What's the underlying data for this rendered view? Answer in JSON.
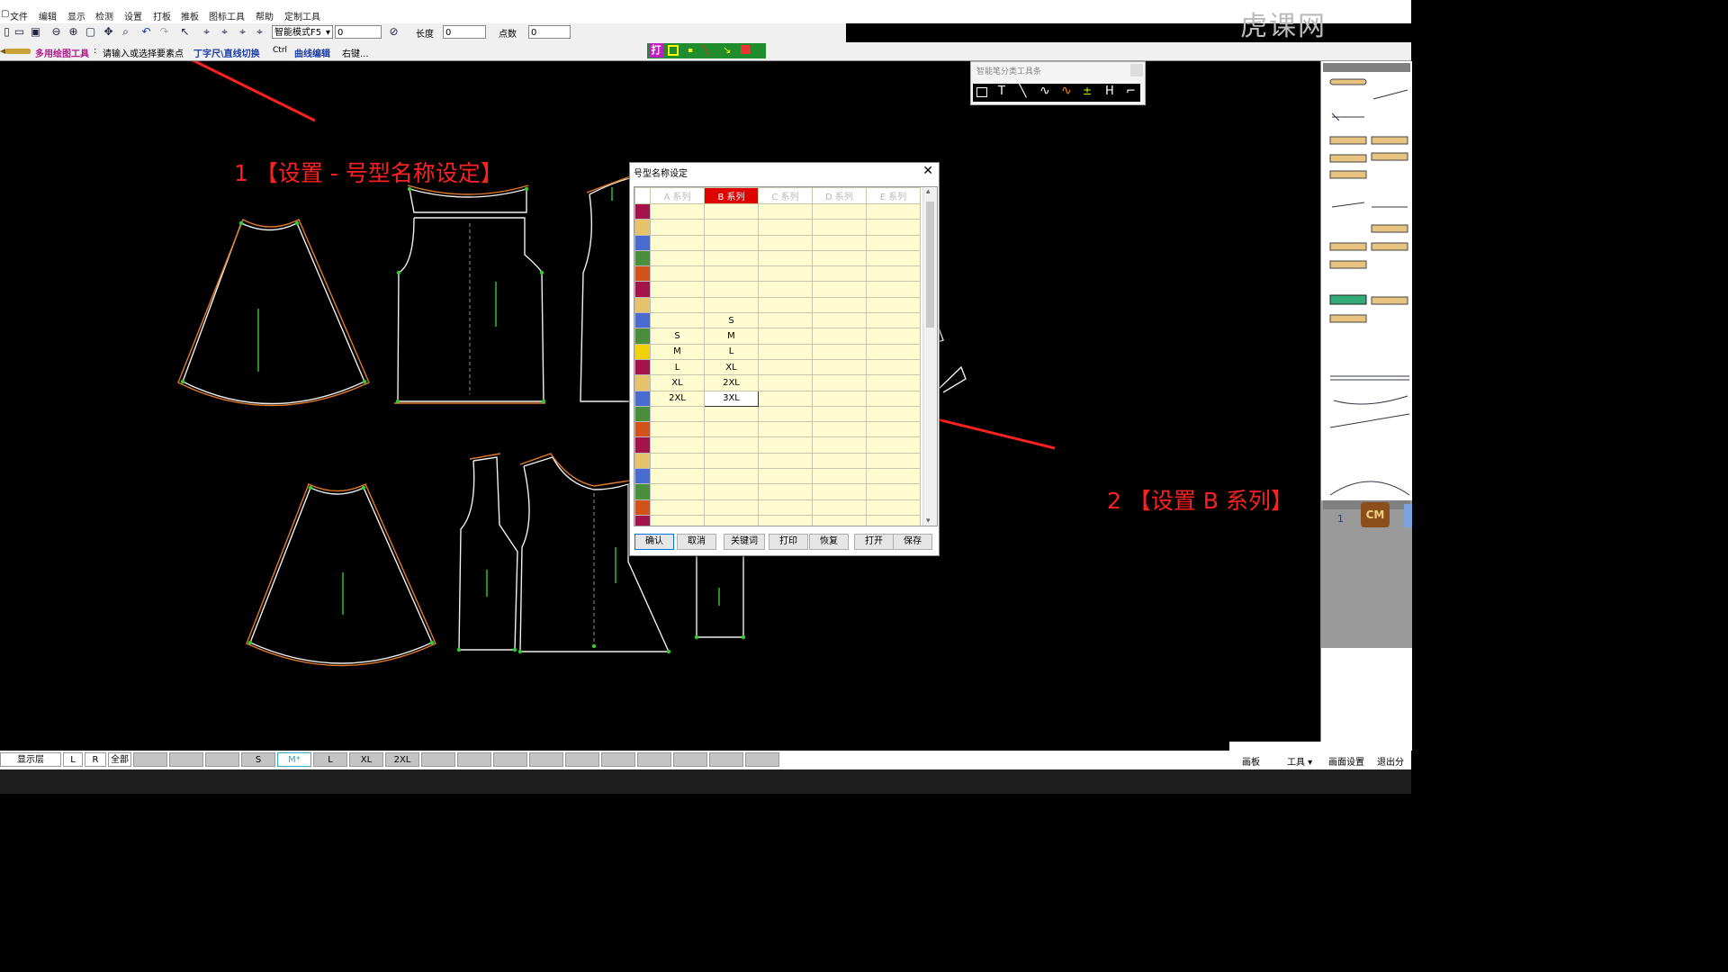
{
  "menubar": {
    "items": [
      "文件",
      "编辑",
      "显示",
      "检测",
      "设置",
      "打板",
      "推板",
      "图标工具",
      "帮助",
      "定制工具"
    ]
  },
  "toolbar": {
    "mode_select": "智能模式F5",
    "mode_value": "0",
    "length_label": "长度",
    "length_value": "0",
    "points_label": "点数",
    "points_value": "0"
  },
  "statusline": {
    "tool_name": "多用绘图工具",
    "prompt": "请输入或选择要素点",
    "switch_hint": "丁字尺\\直线切换",
    "ctrl_key": "Ctrl",
    "curve_edit": "曲线编辑",
    "curve_key": "右键..."
  },
  "float_toolbar": {
    "title": "智能笔分类工具条"
  },
  "dialog": {
    "title": "号型名称设定",
    "columns": [
      "A 系列",
      "B 系列",
      "C 系列",
      "D 系列",
      "E 系列"
    ],
    "active_column": "B 系列",
    "swatch_colors": [
      "#a3154a",
      "#e6c26a",
      "#4a6bd0",
      "#4b8e3c",
      "#d2521a",
      "#a3154a",
      "#e6c26a",
      "#4a6bd0",
      "#4b8e3c",
      "#f1d20a",
      "#a3154a",
      "#e6c26a",
      "#4a6bd0",
      "#4b8e3c",
      "#d2521a",
      "#a3154a",
      "#e6c26a",
      "#4a6bd0",
      "#4b8e3c",
      "#d2521a",
      "#a3154a"
    ],
    "a_series": [
      "S",
      "M",
      "L",
      "XL",
      "2XL"
    ],
    "b_series": [
      "S",
      "M",
      "L",
      "XL",
      "2XL",
      "3XL"
    ],
    "buttons": [
      "确认",
      "取消",
      "关键词",
      "打印",
      "恢复",
      "打开",
      "保存"
    ]
  },
  "annotations": {
    "step1": "1 【设置 - 号型名称设定】",
    "step2": "2 【设置 B 系列】",
    "color": "#ff2020"
  },
  "statusbar": {
    "layer_label": "显示层",
    "btn_l": "L",
    "btn_r": "R",
    "btn_all": "全部",
    "sizes": [
      "S",
      "M*",
      "L",
      "XL",
      "2XL"
    ],
    "active_size": "M*",
    "right_tabs": [
      "画板",
      "工具 ▾",
      "画面设置",
      "退出分享"
    ]
  },
  "right_panel": {
    "cm_label": "CM",
    "page_number": "1"
  },
  "watermark": "虎课网"
}
